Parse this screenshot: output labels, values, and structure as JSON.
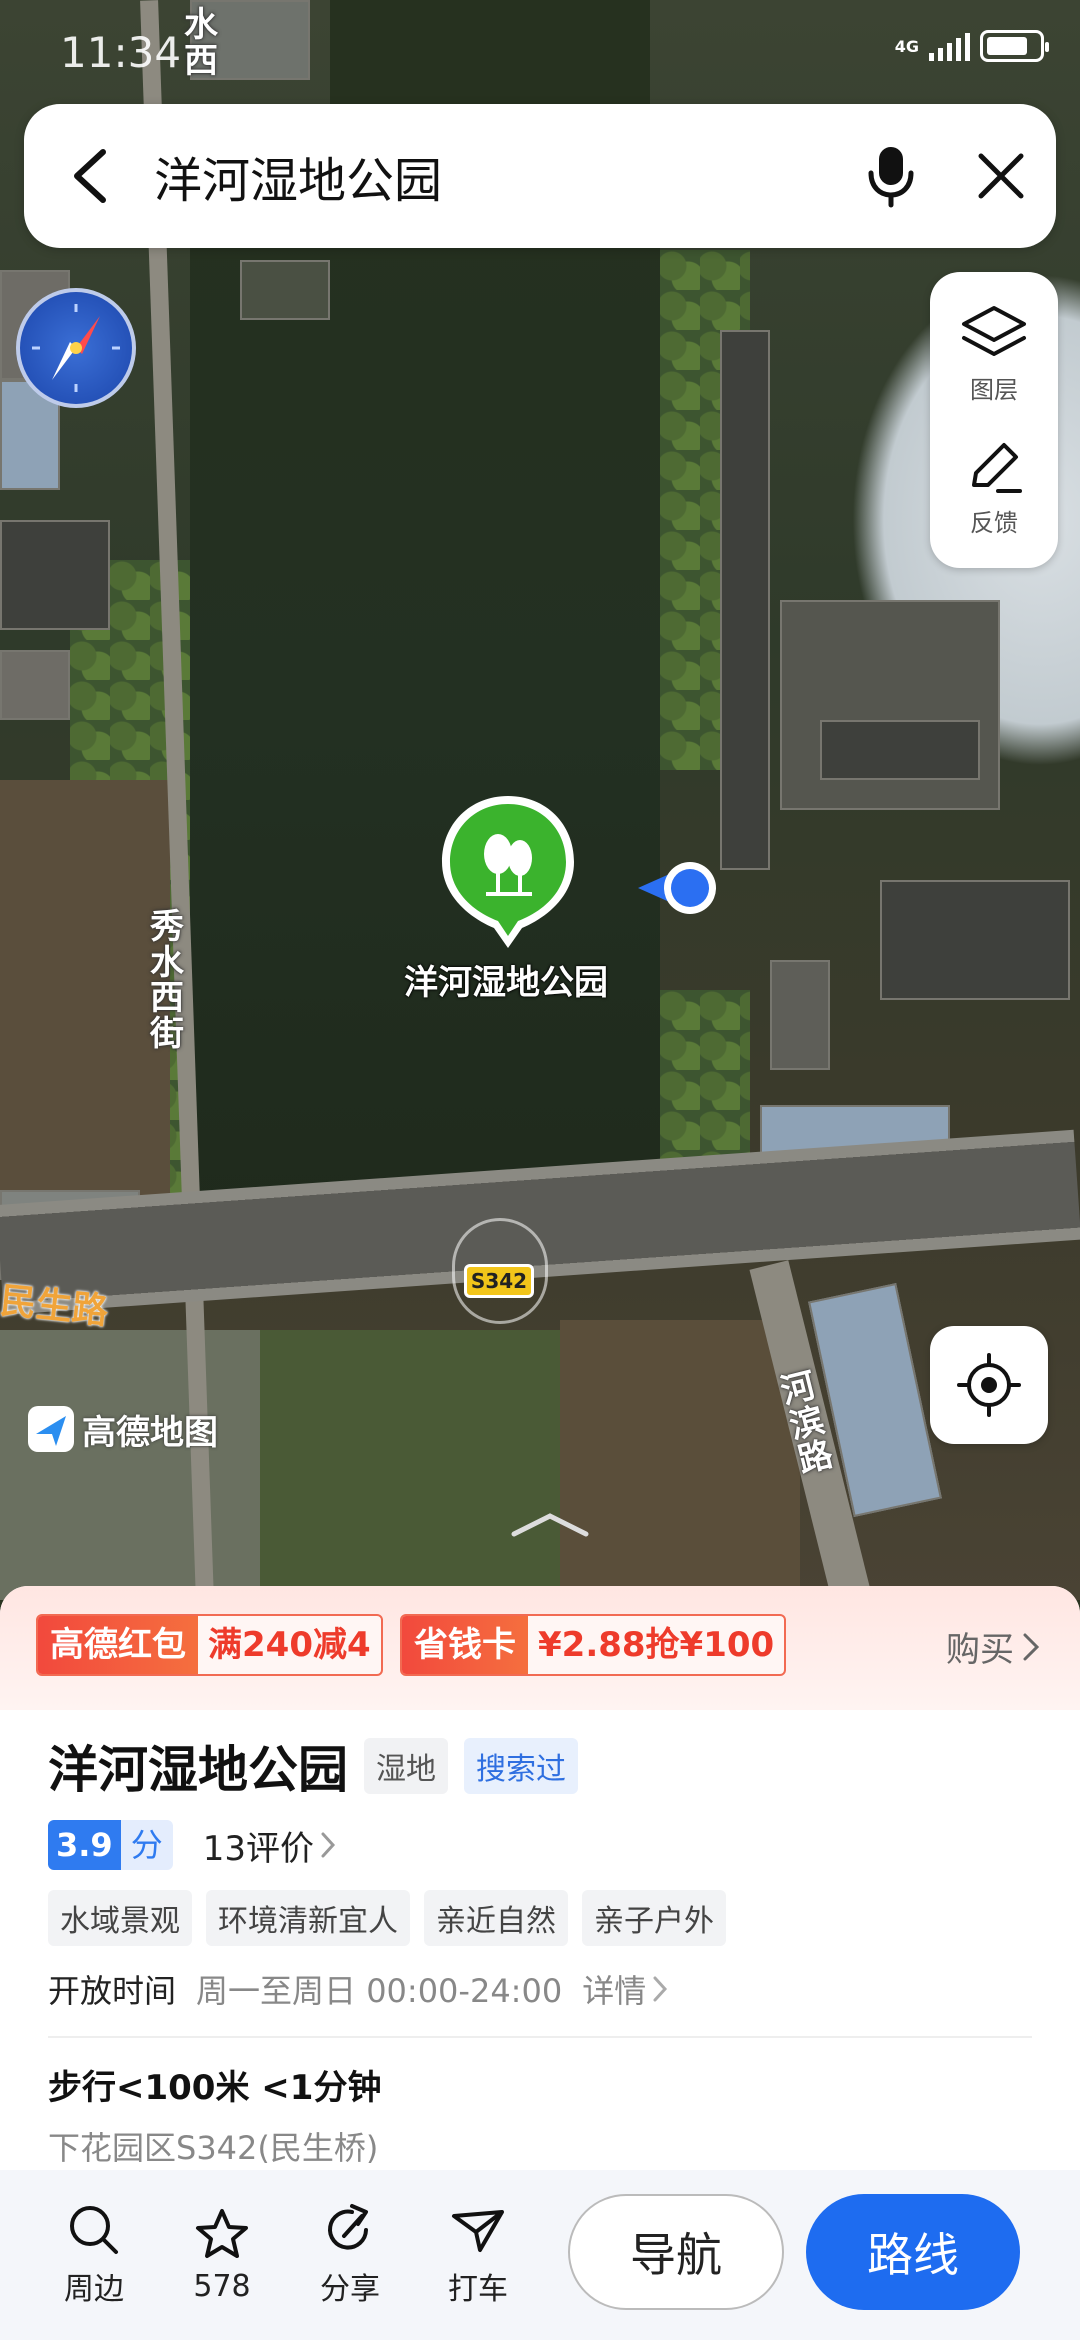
{
  "status": {
    "time": "11:34",
    "network": "4G",
    "battery_level": 0.8
  },
  "search": {
    "query": "洋河湿地公园"
  },
  "tools": {
    "layers_label": "图层",
    "feedback_label": "反馈"
  },
  "map": {
    "poi_label": "洋河湿地公园",
    "road_labels": {
      "top": "水西",
      "left": "秀水西街",
      "bottom_left": "民生路",
      "bottom_right": "河滨路"
    },
    "route_shield": "S342",
    "logo_text": "高德地图"
  },
  "promo": {
    "coupon1_tag": "高德红包",
    "coupon1_value": "满240减4",
    "coupon2_tag": "省钱卡",
    "coupon2_value": "¥2.88抢¥100",
    "buy_label": "购买"
  },
  "place": {
    "name": "洋河湿地公园",
    "category": "湿地",
    "searched_badge": "搜索过",
    "score": "3.9",
    "score_unit": "分",
    "reviews": "13评价",
    "tags": [
      "水域景观",
      "环境清新宜人",
      "亲近自然",
      "亲子户外"
    ],
    "hours_label": "开放时间",
    "hours_value": "周一至周日 00:00-24:00",
    "hours_detail": "详情",
    "walk_info": "步行<100米 <1分钟",
    "address": "下花园区S342(民生桥)"
  },
  "actions": {
    "nearby": "周边",
    "favorites": "578",
    "share": "分享",
    "taxi": "打车",
    "navigate": "导航",
    "route": "路线"
  },
  "colors": {
    "accent_blue": "#1e6cf0",
    "poi_green": "#3bb32d",
    "promo_red": "#f2493d"
  }
}
